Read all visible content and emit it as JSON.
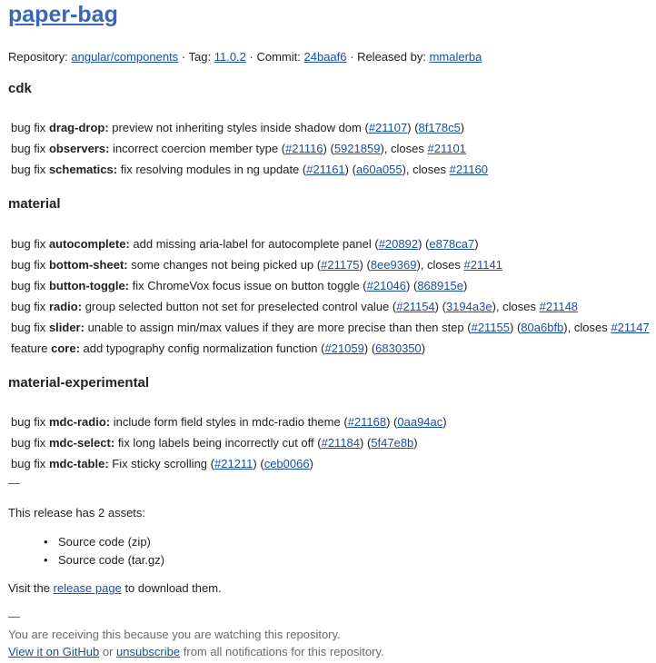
{
  "title": "paper-bag",
  "meta": {
    "repo_label": "Repository:",
    "repo": "angular/components",
    "tag_label": "· Tag:",
    "tag": "11.0.2",
    "commit_label": "· Commit:",
    "commit": "24baaf6",
    "released_label": "· Released by:",
    "released_by": "mmalerba"
  },
  "sections": [
    {
      "name": "cdk",
      "entries": [
        {
          "kind": "bug fix",
          "scope": "drag-drop:",
          "desc": "preview not inheriting styles inside shadow dom",
          "pr": "#21107",
          "hash": "8f178c5"
        },
        {
          "kind": "bug fix",
          "scope": "observers:",
          "desc": "incorrect coercion member type",
          "pr": "#21116",
          "hash": "5921859",
          "closes_label": ", closes",
          "closes": "#21101"
        },
        {
          "kind": "bug fix",
          "scope": "schematics:",
          "desc": "fix resolving modules in ng update",
          "pr": "#21161",
          "hash": "a60a055",
          "closes_label": ", closes",
          "closes": "#21160"
        }
      ]
    },
    {
      "name": "material",
      "entries": [
        {
          "kind": "bug fix",
          "scope": "autocomplete:",
          "desc": "add missing aria-label for autocomplete panel",
          "pr": "#20892",
          "hash": "e878ca7"
        },
        {
          "kind": "bug fix",
          "scope": "bottom-sheet:",
          "desc": "some changes not being picked up",
          "pr": "#21175",
          "hash": "8ee9369",
          "closes_label": ", closes",
          "closes": "#21141"
        },
        {
          "kind": "bug fix",
          "scope": "button-toggle:",
          "desc": "fix ChromeVox focus issue on button toggle",
          "pr": "#21046",
          "hash": "868915e"
        },
        {
          "kind": "bug fix",
          "scope": "radio:",
          "desc": "group selected button not set for preselected control value",
          "pr": "#21154",
          "hash": "3194a3e",
          "closes_label": ", closes",
          "closes": "#21148"
        },
        {
          "kind": "bug fix",
          "scope": "slider:",
          "desc": "unable to assign min/max values if they are more precise than then step",
          "pr": "#21155",
          "hash": "80a6bfb",
          "closes_label": ", closes",
          "closes": "#21147"
        },
        {
          "kind": "feature",
          "scope": "core:",
          "desc": "add typography config normalization function",
          "pr": "#21059",
          "hash": "6830350"
        }
      ]
    },
    {
      "name": "material-experimental",
      "entries": [
        {
          "kind": "bug fix",
          "scope": "mdc-radio:",
          "desc": "include form field styles in mdc-radio theme",
          "pr": "#21168",
          "hash": "0aa94ac"
        },
        {
          "kind": "bug fix",
          "scope": "mdc-select:",
          "desc": "fix long labels being incorrectly cut off",
          "pr": "#21184",
          "hash": "5f47e8b"
        },
        {
          "kind": "bug fix",
          "scope": "mdc-table:",
          "desc": "Fix sticky scrolling",
          "pr": "#21211",
          "hash": "ceb0066"
        }
      ]
    }
  ],
  "separator": "—",
  "assets_intro": "This release has 2 assets:",
  "assets": [
    "Source code (zip)",
    "Source code (tar.gz)"
  ],
  "bullet": "•",
  "visit": {
    "before": "Visit the",
    "link": "release page",
    "after": "to download them."
  },
  "footer": {
    "line1": "You are receiving this because you are watching this repository.",
    "view_link": "View it on GitHub",
    "or": "or",
    "unsubscribe_link": "unsubscribe",
    "rest": "from all notifications for this repository."
  },
  "colors": {
    "link": "#1a4f9e",
    "title_link": "#3b66b8",
    "text": "#222222",
    "footer_text": "#6b6b6b"
  }
}
